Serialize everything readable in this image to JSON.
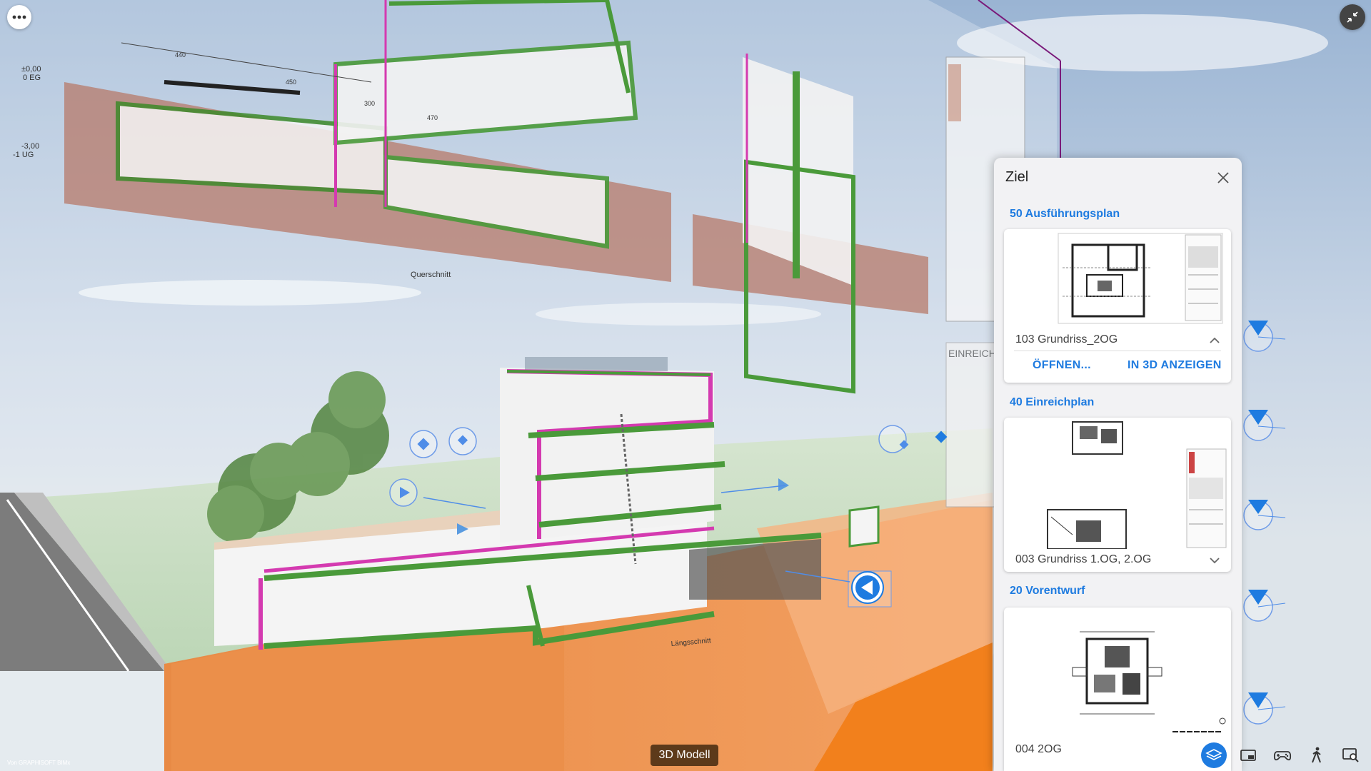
{
  "app": {
    "credit": "Von GRAPHISOFT BIMx",
    "view_mode_label": "3D Modell"
  },
  "toolbar_top": {
    "more_icon": "more-dots-icon",
    "collapse_icon": "collapse-arrows-icon"
  },
  "panel": {
    "title": "Ziel",
    "close_icon": "close-icon",
    "sections": [
      {
        "label": "50 Ausführungsplan",
        "sheet": "103 Grundriss_2OG",
        "expanded": true,
        "actions": [
          "ÖFFNEN...",
          "IN 3D ANZEIGEN"
        ]
      },
      {
        "label": "40 Einreichplan",
        "sheet": "003 Grundriss 1.OG, 2.OG",
        "expanded": false
      },
      {
        "label": "20 Vorentwurf",
        "sheet": "004 2OG",
        "expanded": false
      }
    ]
  },
  "bottom_tools": [
    {
      "icon": "layer-stack-icon",
      "active": true
    },
    {
      "icon": "sheet-view-icon",
      "active": false
    },
    {
      "icon": "gamepad-icon",
      "active": false
    },
    {
      "icon": "walk-mode-icon",
      "active": false
    },
    {
      "icon": "search-window-icon",
      "active": false
    }
  ],
  "drawing_labels": {
    "level_0": "±0,00",
    "level_0_name": "0 EG",
    "level_1": "-3,00",
    "level_1_name": "-1 UG",
    "section_name": "Querschnitt",
    "long_section_name": "Längsschnitt",
    "sheet_heading": "EINREICHPL",
    "dims": [
      "440",
      "450",
      "470",
      "300"
    ]
  },
  "colors": {
    "accent": "#1e7be0",
    "orange": "#e07a35",
    "terrain": "#f4a56d",
    "pink": "#e0409a",
    "green": "#4a9a3a"
  }
}
